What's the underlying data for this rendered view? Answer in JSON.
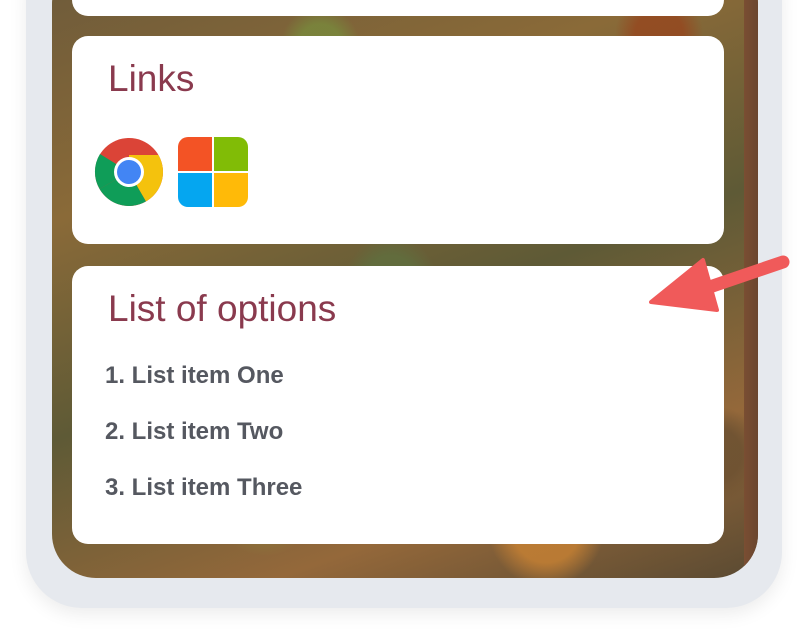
{
  "links_card": {
    "title": "Links",
    "apps": [
      {
        "name": "Chrome",
        "icon": "chrome-icon"
      },
      {
        "name": "Microsoft",
        "icon": "microsoft-icon"
      }
    ]
  },
  "list_card": {
    "title": "List of options",
    "items": [
      "1. List item One",
      "2. List item Two",
      "3. List item Three"
    ]
  },
  "colors": {
    "title": "#8a3a4e",
    "list_text": "#555860",
    "arrow": "#f05a5a",
    "frame": "#e6e9ee"
  }
}
